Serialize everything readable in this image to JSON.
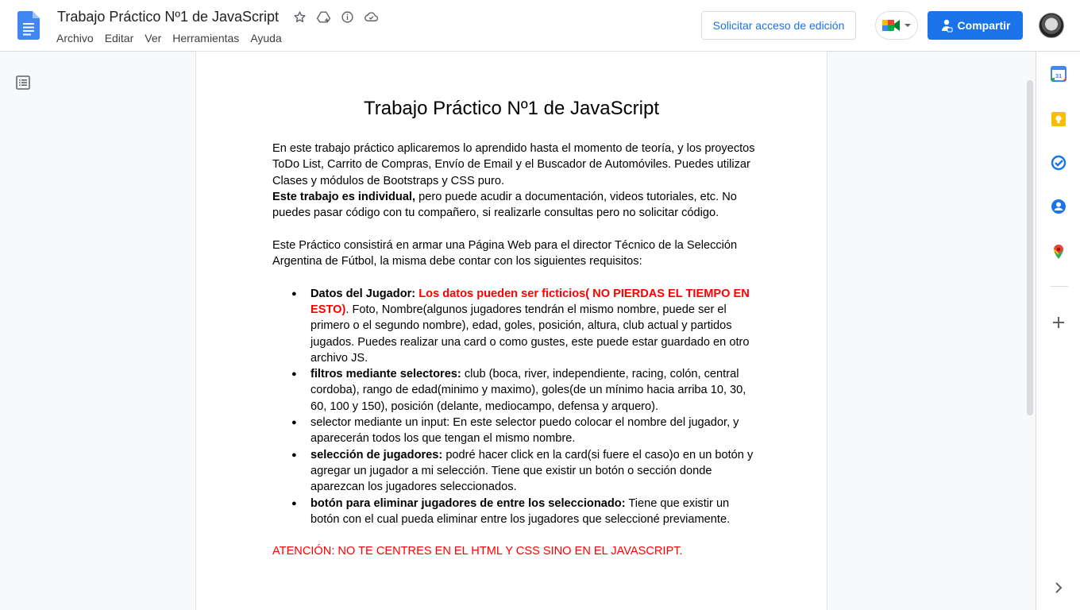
{
  "header": {
    "doc_title": "Trabajo Práctico Nº1 de JavaScript",
    "menu": [
      "Archivo",
      "Editar",
      "Ver",
      "Herramientas",
      "Ayuda"
    ],
    "request_edit_label": "Solicitar acceso de edición",
    "share_label": "Compartir"
  },
  "document": {
    "title": "Trabajo Práctico Nº1 de JavaScript",
    "intro": "En este trabajo práctico aplicaremos lo aprendido hasta el momento de teoría, y los proyectos ToDo List, Carrito de Compras, Envío de Email y el Buscador de Automóviles. Puedes utilizar Clases y módulos de Bootstraps y CSS puro.",
    "individual_bold": "Este trabajo es individual,",
    "individual_rest": " pero puede acudir a documentación, videos tutoriales, etc. No puedes pasar código con tu compañero, si realizarle consultas pero no solicitar código.",
    "practice_intro": "Este Práctico consistirá en armar una Página Web  para el director Técnico de la Selección Argentina de Fútbol, la misma debe contar con los siguientes requisitos:",
    "items": [
      {
        "bold": "Datos del Jugador: ",
        "red": "Los datos pueden ser ficticios(  NO PIERDAS EL TIEMPO EN ESTO)",
        "rest": ". Foto, Nombre(algunos jugadores tendrán el mismo nombre, puede ser el primero o el segundo nombre), edad, goles, posición, altura, club actual y partidos jugados. Puedes realizar una card o como gustes, este puede estar guardado en otro archivo JS."
      },
      {
        "bold": "filtros mediante selectores:",
        "red": "",
        "rest": " club (boca, river, independiente, racing, colón, central cordoba), rango de edad(minimo y maximo), goles(de un mínimo hacia arriba 10, 30, 60, 100 y 150), posición (delante, mediocampo, defensa y arquero)."
      },
      {
        "bold": "",
        "red": "",
        "rest": "selector mediante un input: En este selector puedo colocar el nombre del jugador, y aparecerán todos los que tengan el mismo nombre."
      },
      {
        "bold": "selección de jugadores:",
        "red": "",
        "rest": " podré hacer click en la card(si fuere el caso)o en un botón y agregar un jugador a mi selección. Tiene que existir un botón  o sección donde aparezcan los jugadores seleccionados."
      },
      {
        "bold": "botón para eliminar jugadores de entre los seleccionado:",
        "red": "",
        "rest": " Tiene que existir un botón con el cual pueda eliminar entre los jugadores que seleccioné previamente."
      }
    ],
    "attention": "ATENCIÓN: NO TE CENTRES EN EL HTML Y CSS SINO EN EL JAVASCRIPT."
  },
  "side_panel": {
    "calendar_day": "31"
  },
  "colors": {
    "accent": "#1a73e8",
    "warning_red": "#ff0000"
  }
}
